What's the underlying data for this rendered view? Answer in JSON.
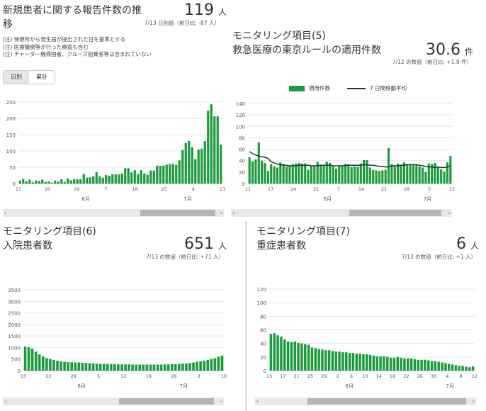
{
  "panels": {
    "p1": {
      "title_line1": "新規患者に関する報告件数の推",
      "title_line2": "移",
      "value": "119",
      "unit": "人",
      "sub": "7/13 日別値（前日比: -87 人）",
      "notes": [
        "(注) 保健所から発生届が提出された日を基準とする",
        "(注) 医療機関等が行った検査も含む",
        "(注) チャーター機帰国者、クルーズ船乗客等は含まれていない"
      ],
      "toggle": [
        "日別",
        "累計"
      ],
      "y_ticks": [
        "250",
        "200",
        "150",
        "100",
        "50",
        "0"
      ],
      "x_ticks": [
        "11",
        "20",
        "29",
        "7",
        "18",
        "25",
        "4",
        "13"
      ],
      "month_labels": [
        "6月",
        "7月"
      ]
    },
    "p2": {
      "section": "モニタリング項目(5)",
      "title": "救急医療の東京ルールの適用件数",
      "value": "30.6",
      "unit": "件",
      "sub": "7/12 の数値（前日比: +1.9 件）",
      "legend_bar": "適用件数",
      "legend_line": "7 日間移動平均",
      "y_ticks": [
        "140",
        "120",
        "100",
        "80",
        "60",
        "40",
        "20",
        "0"
      ],
      "x_ticks": [
        "11",
        "17",
        "24",
        "31",
        "7",
        "14",
        "21",
        "28",
        "5",
        "12"
      ],
      "month_labels": [
        "6月",
        "7月"
      ]
    },
    "p3": {
      "section": "モニタリング項目(6)",
      "title": "入院患者数",
      "value": "651",
      "unit": "人",
      "sub": "7/13 の数値（前日比: +71 人）",
      "y_ticks": [
        "3500",
        "3000",
        "2500",
        "2000",
        "1500",
        "1000",
        "500",
        "0"
      ],
      "x_ticks": [
        "15",
        "22",
        "29",
        "5",
        "12",
        "19",
        "26",
        "3",
        "10"
      ],
      "month_labels": [
        "6月",
        "7月"
      ]
    },
    "p4": {
      "section": "モニタリング項目(7)",
      "title": "重症患者数",
      "value": "6",
      "unit": "人",
      "sub": "7/13 の数値（前日比: +1 人）",
      "y_ticks": [
        "120",
        "100",
        "80",
        "60",
        "40",
        "20",
        "0"
      ],
      "x_ticks": [
        "13",
        "17",
        "21",
        "25",
        "29",
        "2",
        "6",
        "10",
        "14",
        "18",
        "22",
        "26",
        "30",
        "4",
        "8",
        "12"
      ],
      "month_labels": [
        "6月",
        "7月"
      ]
    }
  },
  "colors": {
    "bar": "#1a9b3c",
    "line": "#1d3b2a",
    "grid": "#e6e6e6"
  },
  "chart_data": [
    {
      "type": "bar",
      "title": "新規患者に関する報告件数の推移",
      "ylim": [
        0,
        250
      ],
      "values": [
        9,
        14,
        7,
        12,
        4,
        9,
        8,
        12,
        5,
        6,
        3,
        9,
        6,
        13,
        5,
        16,
        10,
        14,
        13,
        13,
        29,
        18,
        19,
        22,
        35,
        22,
        18,
        26,
        24,
        28,
        28,
        28,
        31,
        47,
        47,
        34,
        41,
        29,
        41,
        31,
        27,
        40,
        40,
        55,
        54,
        55,
        58,
        60,
        60,
        57,
        71,
        103,
        124,
        131,
        111,
        75,
        104,
        107,
        130,
        224,
        243,
        206,
        206,
        119
      ]
    },
    {
      "type": "bar",
      "title": "救急医療の東京ルールの適用件数",
      "ylim": [
        0,
        140
      ],
      "series": [
        {
          "name": "適用件数",
          "values": [
            46,
            39,
            42,
            72,
            40,
            36,
            22,
            34,
            30,
            28,
            37,
            34,
            30,
            31,
            34,
            35,
            36,
            35,
            35,
            24,
            31,
            30,
            38,
            33,
            32,
            38,
            36,
            30,
            26,
            30,
            31,
            34,
            34,
            29,
            30,
            29,
            35,
            41,
            41,
            28,
            24,
            23,
            22,
            23,
            24,
            62,
            34,
            30,
            35,
            33,
            37,
            34,
            34,
            32,
            33,
            30,
            28,
            20,
            35,
            34,
            36,
            28,
            25,
            21,
            37,
            48
          ]
        },
        {
          "name": "7 日間移動平均",
          "values": [
            56,
            52,
            50,
            48,
            47,
            46,
            44,
            38,
            36,
            34,
            33,
            32,
            32,
            31,
            31,
            31,
            32,
            32,
            32,
            32,
            31,
            31,
            31,
            32,
            32,
            32,
            32,
            31,
            31,
            31,
            31,
            32,
            32,
            32,
            32,
            32,
            32,
            33,
            33,
            32,
            32,
            31,
            30,
            30,
            29,
            29,
            31,
            31,
            31,
            32,
            32,
            33,
            33,
            33,
            33,
            32,
            31,
            30,
            29,
            29,
            28,
            29,
            28,
            28,
            29,
            31
          ]
        }
      ]
    },
    {
      "type": "bar",
      "title": "入院患者数",
      "ylim": [
        0,
        3500
      ],
      "values": [
        1040,
        1010,
        950,
        820,
        700,
        620,
        540,
        500,
        460,
        430,
        400,
        380,
        370,
        360,
        350,
        350,
        340,
        330,
        320,
        310,
        300,
        300,
        290,
        290,
        280,
        280,
        270,
        270,
        270,
        270,
        260,
        260,
        260,
        260,
        260,
        260,
        260,
        260,
        260,
        270,
        270,
        280,
        280,
        290,
        300,
        310,
        330,
        350,
        380,
        400,
        430,
        460,
        500,
        540,
        600,
        651
      ]
    },
    {
      "type": "bar",
      "title": "重症患者数",
      "ylim": [
        0,
        120
      ],
      "values": [
        54,
        55,
        52,
        50,
        46,
        43,
        42,
        43,
        41,
        40,
        39,
        38,
        34,
        33,
        32,
        31,
        30,
        30,
        29,
        28,
        28,
        27,
        27,
        26,
        26,
        25,
        25,
        24,
        24,
        23,
        22,
        21,
        21,
        21,
        20,
        19,
        19,
        20,
        19,
        18,
        18,
        18,
        17,
        16,
        16,
        16,
        15,
        14,
        14,
        13,
        12,
        11,
        10,
        9,
        8,
        7,
        7,
        6,
        5,
        6
      ]
    }
  ]
}
